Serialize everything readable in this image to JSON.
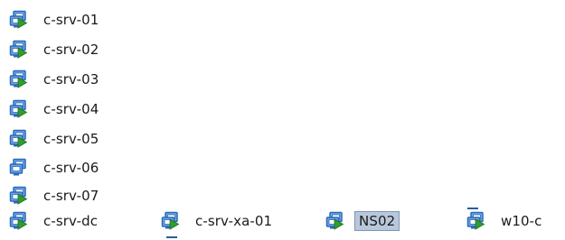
{
  "vms": [
    {
      "name": "c-srv-01",
      "state": "on",
      "icon": "vm-powered-on-icon"
    },
    {
      "name": "c-srv-02",
      "state": "on",
      "icon": "vm-powered-on-icon"
    },
    {
      "name": "c-srv-03",
      "state": "on",
      "icon": "vm-powered-on-icon"
    },
    {
      "name": "c-srv-04",
      "state": "on",
      "icon": "vm-powered-on-icon"
    },
    {
      "name": "c-srv-05",
      "state": "on",
      "icon": "vm-powered-on-icon"
    },
    {
      "name": "c-srv-06",
      "state": "off",
      "icon": "vm-powered-off-icon"
    },
    {
      "name": "c-srv-07",
      "state": "on",
      "icon": "vm-powered-on-icon"
    },
    {
      "name": "c-srv-dc",
      "state": "on",
      "icon": "vm-powered-on-icon"
    },
    {
      "name": "c-srv-xa-01",
      "state": "on",
      "icon": "vm-powered-on-icon"
    },
    {
      "name": "NS02",
      "state": "on",
      "icon": "vm-powered-on-icon",
      "selected": true
    },
    {
      "name": "w10-c",
      "state": "on",
      "icon": "vm-powered-on-icon"
    }
  ],
  "colors": {
    "monitor_blue": "#2b68b8",
    "monitor_light": "#6fa8e6",
    "play_green": "#2f9e2f",
    "selection_bg": "#b8c8dc",
    "selection_border": "#7f96b2"
  }
}
